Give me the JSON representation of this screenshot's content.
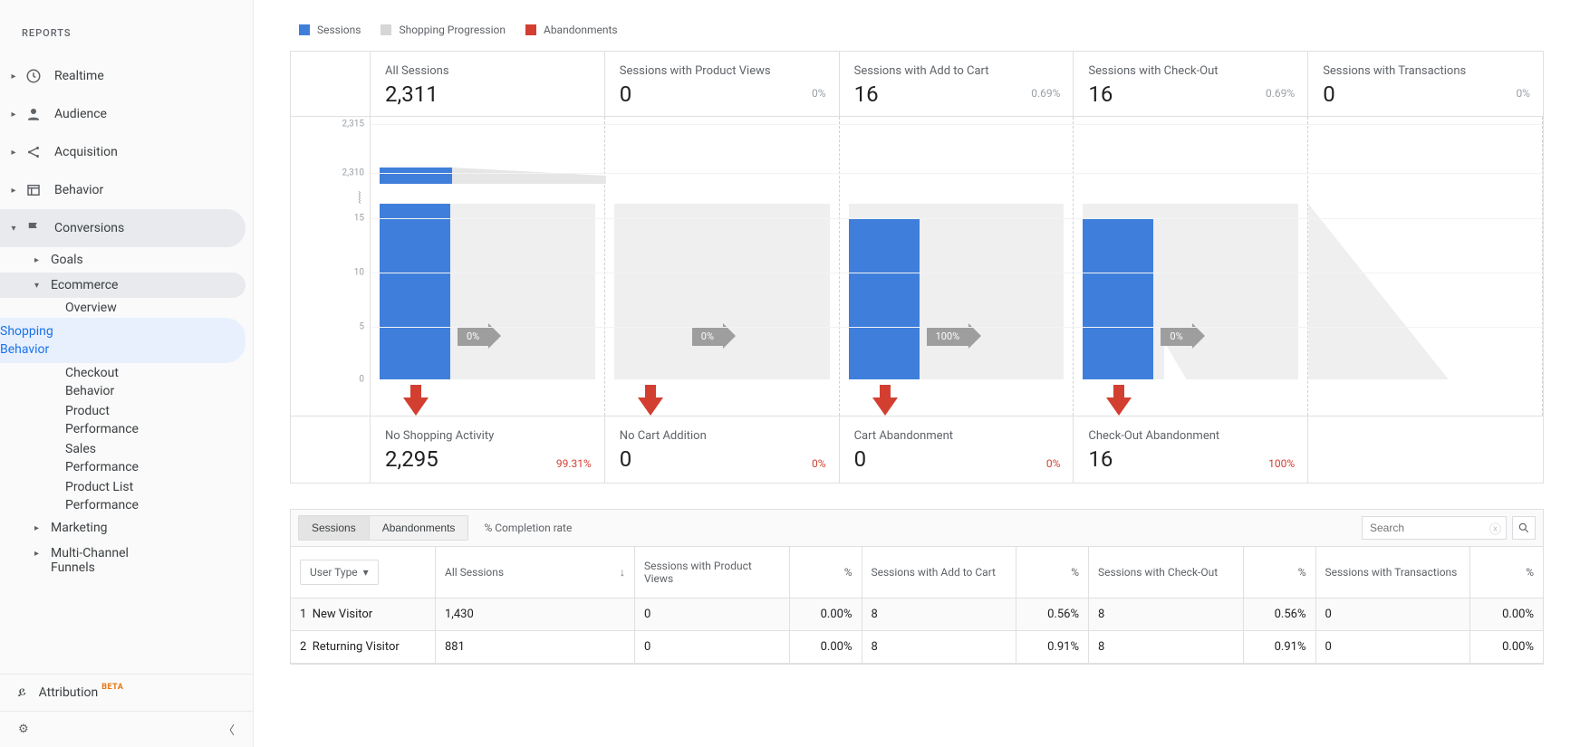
{
  "sidebar": {
    "reports_label": "REPORTS",
    "nav": {
      "realtime": "Realtime",
      "audience": "Audience",
      "acquisition": "Acquisition",
      "behavior": "Behavior",
      "conversions": "Conversions"
    },
    "goals": "Goals",
    "ecommerce": "Ecommerce",
    "leaves": {
      "overview": "Overview",
      "shopping": "Shopping Behavior",
      "checkout": "Checkout Behavior",
      "product": "Product Performance",
      "sales": "Sales Performance",
      "productlist": "Product List Performance"
    },
    "marketing": "Marketing",
    "mcf": "Multi-Channel Funnels",
    "attribution": "Attribution",
    "beta": "BETA"
  },
  "legend": {
    "sessions": "Sessions",
    "progression": "Shopping Progression",
    "abandonments": "Abandonments"
  },
  "chart_data": {
    "type": "bar",
    "y_ticks": [
      "2,315",
      "2,310",
      "15",
      "10",
      "5",
      "0"
    ],
    "columns": [
      {
        "title": "All Sessions",
        "value": "2,311",
        "pct": "",
        "arrow_pct": "0%",
        "bar": true,
        "top": true
      },
      {
        "title": "Sessions with Product Views",
        "value": "0",
        "pct": "0%",
        "arrow_pct": "0%",
        "bar": false,
        "top": false
      },
      {
        "title": "Sessions with Add to Cart",
        "value": "16",
        "pct": "0.69%",
        "arrow_pct": "100%",
        "bar": true,
        "top": false
      },
      {
        "title": "Sessions with Check-Out",
        "value": "16",
        "pct": "0.69%",
        "arrow_pct": "0%",
        "bar": true,
        "top": false
      },
      {
        "title": "Sessions with Transactions",
        "value": "0",
        "pct": "0%",
        "arrow_pct": "",
        "bar": false,
        "top": false
      }
    ],
    "footer": [
      {
        "title": "No Shopping Activity",
        "value": "2,295",
        "pct": "99.31%"
      },
      {
        "title": "No Cart Addition",
        "value": "0",
        "pct": "0%"
      },
      {
        "title": "Cart Abandonment",
        "value": "0",
        "pct": "0%"
      },
      {
        "title": "Check-Out Abandonment",
        "value": "16",
        "pct": "100%"
      }
    ]
  },
  "tabs": {
    "sessions": "Sessions",
    "abandonments": "Abandonments",
    "completion": "% Completion rate"
  },
  "search": {
    "placeholder": "Search"
  },
  "table": {
    "user_type": "User Type",
    "head": {
      "all": "All Sessions",
      "pv": "Sessions with Product Views",
      "pct": "%",
      "atc": "Sessions with Add to Cart",
      "co": "Sessions with Check-Out",
      "tx": "Sessions with Transactions"
    },
    "rows": [
      {
        "idx": "1",
        "type": "New Visitor",
        "all": "1,430",
        "pv": "0",
        "pv_pct": "0.00%",
        "atc": "8",
        "atc_pct": "0.56%",
        "co": "8",
        "co_pct": "0.56%",
        "tx": "0",
        "tx_pct": "0.00%"
      },
      {
        "idx": "2",
        "type": "Returning Visitor",
        "all": "881",
        "pv": "0",
        "pv_pct": "0.00%",
        "atc": "8",
        "atc_pct": "0.91%",
        "co": "8",
        "co_pct": "0.91%",
        "tx": "0",
        "tx_pct": "0.00%"
      }
    ]
  }
}
